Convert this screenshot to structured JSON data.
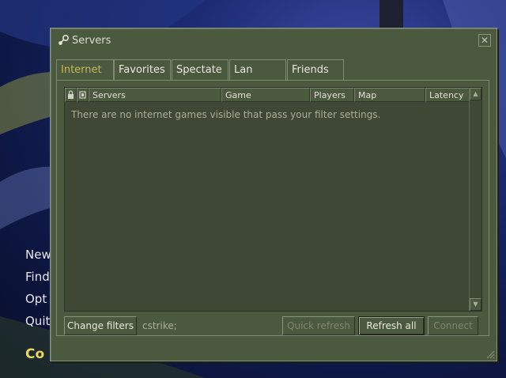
{
  "window": {
    "title": "Servers",
    "close_label": "✕",
    "icon": "steam-icon"
  },
  "tabs": [
    {
      "label": "Internet",
      "active": true
    },
    {
      "label": "Favorites",
      "active": false
    },
    {
      "label": "Spectate",
      "active": false
    },
    {
      "label": "Lan",
      "active": false
    },
    {
      "label": "Friends",
      "active": false
    }
  ],
  "columns": [
    {
      "name": "lock",
      "icon": "lock-icon"
    },
    {
      "name": "vac",
      "icon": "shield-icon"
    },
    {
      "label": "Servers"
    },
    {
      "label": "Game"
    },
    {
      "label": "Players"
    },
    {
      "label": "Map"
    },
    {
      "label": "Latency"
    }
  ],
  "empty_message": "There are no internet games visible that pass your filter settings.",
  "bottom": {
    "change_filters_label": "Change filters",
    "filter_text": "cstrike;",
    "quick_refresh_label": "Quick refresh",
    "refresh_all_label": "Refresh all",
    "connect_label": "Connect"
  },
  "background_menu": [
    "New",
    "Find",
    "Opt",
    "Quit"
  ],
  "background_logo": "Co",
  "colors": {
    "panel": "#4b5a3f",
    "list": "#3e4834",
    "active_tab": "#c8b850"
  }
}
